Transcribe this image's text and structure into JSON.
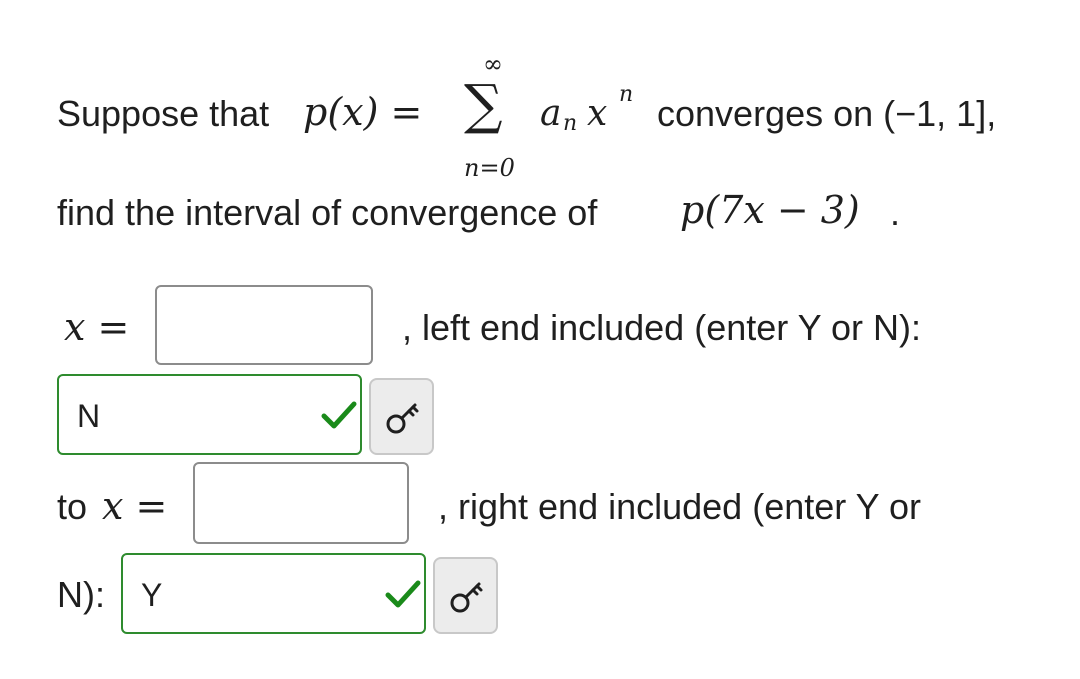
{
  "problem": {
    "line1_prefix": "Suppose that",
    "line1_suffix": "converges on (−1, 1],",
    "line2_prefix": "find the interval of convergence of",
    "line2_suffix": ".",
    "math": {
      "p_of_x": "p(x) =",
      "sum_symbol": "∑",
      "sum_upper": "∞",
      "sum_lower": "n=0",
      "term_base": "a",
      "term_sub": "n",
      "term_x": "x",
      "term_exp": "n",
      "p_of_transformed": "p(7x − 3)"
    }
  },
  "row1": {
    "x_eq_label": "x =",
    "input_value": "",
    "after_text": ", left end included (enter Y or N):"
  },
  "row2": {
    "answer_value": "N",
    "check_status": "correct",
    "key_icon": "key-icon"
  },
  "row3": {
    "to_label": "to",
    "x_eq_label": "x =",
    "input_value": "",
    "after_text": ", right end included (enter Y or"
  },
  "row4": {
    "prefix": "N):",
    "answer_value": "Y",
    "check_status": "correct",
    "key_icon": "key-icon"
  },
  "colors": {
    "correct_green": "#2e8b2e",
    "check_green": "#1a8a1a",
    "neutral_border": "#8c8c8c",
    "key_button_bg": "#ececec"
  }
}
